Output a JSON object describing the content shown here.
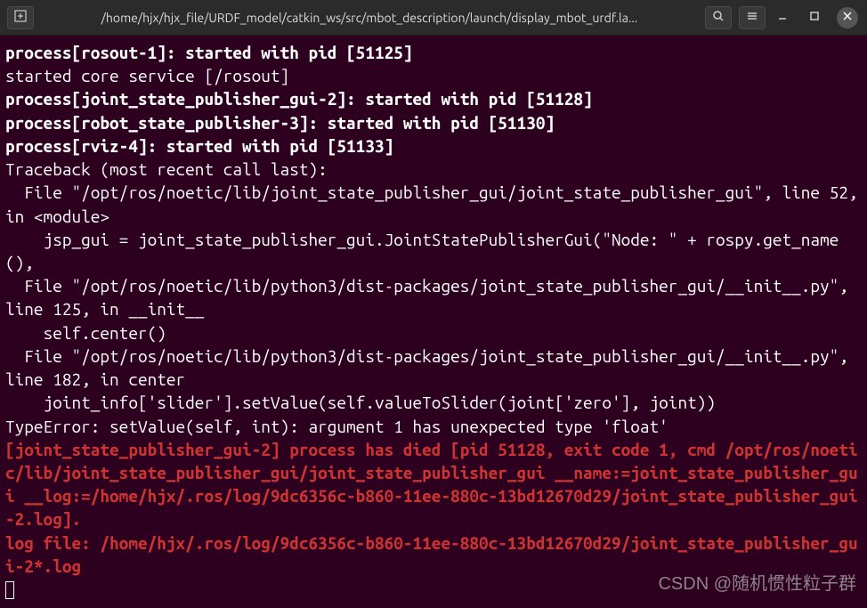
{
  "titlebar": {
    "new_tab_icon": "⊞",
    "title": "/home/hjx/hjx_file/URDF_model/catkin_ws/src/mbot_description/launch/display_mbot_urdf.la...",
    "search_icon": "Q",
    "menu_icon": "≡",
    "minimize": "—",
    "maximize": "□",
    "close": "✕"
  },
  "terminal": {
    "lines": [
      {
        "text": "process[rosout-1]: started with pid [51125]",
        "class": "bold"
      },
      {
        "text": "started core service [/rosout]",
        "class": ""
      },
      {
        "text": "process[joint_state_publisher_gui-2]: started with pid [51128]",
        "class": "bold"
      },
      {
        "text": "process[robot_state_publisher-3]: started with pid [51130]",
        "class": "bold"
      },
      {
        "text": "process[rviz-4]: started with pid [51133]",
        "class": "bold"
      },
      {
        "text": "Traceback (most recent call last):",
        "class": ""
      },
      {
        "text": "  File \"/opt/ros/noetic/lib/joint_state_publisher_gui/joint_state_publisher_gui\", line 52, in <module>",
        "class": ""
      },
      {
        "text": "    jsp_gui = joint_state_publisher_gui.JointStatePublisherGui(\"Node: \" + rospy.get_name(),",
        "class": ""
      },
      {
        "text": "  File \"/opt/ros/noetic/lib/python3/dist-packages/joint_state_publisher_gui/__init__.py\", line 125, in __init__",
        "class": ""
      },
      {
        "text": "    self.center()",
        "class": ""
      },
      {
        "text": "  File \"/opt/ros/noetic/lib/python3/dist-packages/joint_state_publisher_gui/__init__.py\", line 182, in center",
        "class": ""
      },
      {
        "text": "    joint_info['slider'].setValue(self.valueToSlider(joint['zero'], joint))",
        "class": ""
      },
      {
        "text": "TypeError: setValue(self, int): argument 1 has unexpected type 'float'",
        "class": ""
      },
      {
        "text": "[joint_state_publisher_gui-2] process has died [pid 51128, exit code 1, cmd /opt/ros/noetic/lib/joint_state_publisher_gui/joint_state_publisher_gui __name:=joint_state_publisher_gui __log:=/home/hjx/.ros/log/9dc6356c-b860-11ee-880c-13bd12670d29/joint_state_publisher_gui-2.log].",
        "class": "bold error"
      },
      {
        "text": "log file: /home/hjx/.ros/log/9dc6356c-b860-11ee-880c-13bd12670d29/joint_state_publisher_gui-2*.log",
        "class": "bold error"
      }
    ]
  },
  "watermark": "CSDN @随机惯性粒子群"
}
